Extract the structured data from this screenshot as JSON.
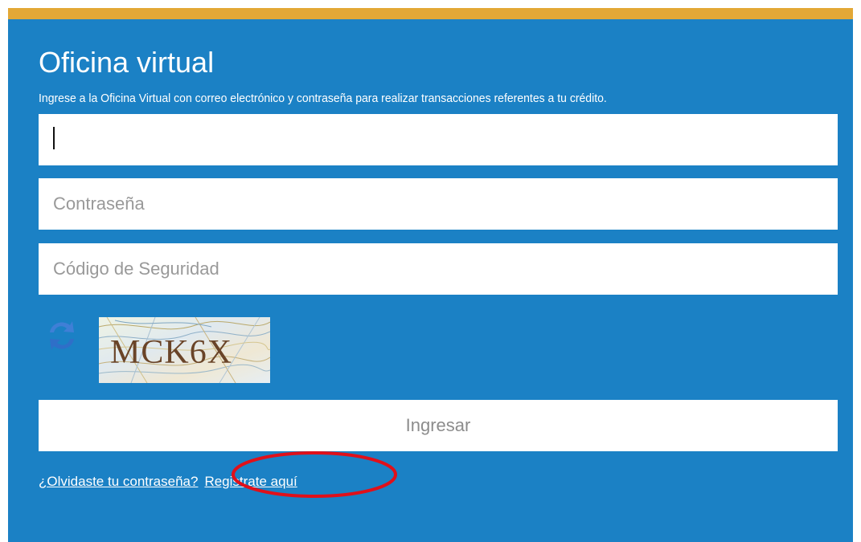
{
  "login": {
    "title": "Oficina virtual",
    "subtitle": "Ingrese a la Oficina Virtual con correo electrónico y contraseña para realizar transacciones referentes a tu crédito.",
    "email": {
      "value": "",
      "placeholder": ""
    },
    "password": {
      "value": "",
      "placeholder": "Contraseña"
    },
    "security_code": {
      "value": "",
      "placeholder": "Código de Seguridad"
    },
    "captcha": {
      "text": "MCK6X"
    },
    "submit_label": "Ingresar",
    "forgot_label": "¿Olvidaste tu contraseña?",
    "register_label": "Registrate aquí"
  },
  "colors": {
    "panel": "#1b81c5",
    "top_strip": "#e3a836",
    "highlight": "#e0101a"
  },
  "icons": {
    "refresh": "refresh-arrows-icon"
  }
}
